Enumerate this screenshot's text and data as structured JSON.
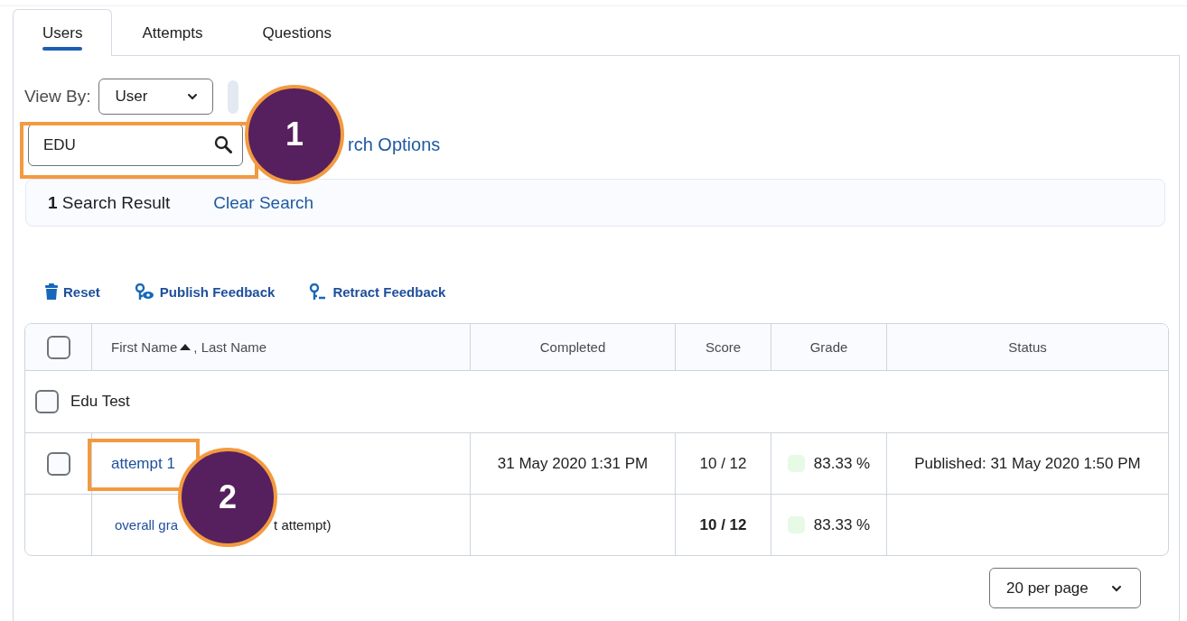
{
  "tabs": [
    {
      "label": "Users",
      "selected": true
    },
    {
      "label": "Attempts",
      "selected": false
    },
    {
      "label": "Questions",
      "selected": false
    }
  ],
  "view_by": {
    "label": "View By:",
    "value": "User"
  },
  "search": {
    "value": "EDU",
    "options_link": "rch Options"
  },
  "search_results": {
    "count": "1",
    "label": "Search Result",
    "clear": "Clear Search"
  },
  "toolbar": [
    {
      "kind": "reset",
      "label": "Reset"
    },
    {
      "kind": "publish",
      "label": "Publish Feedback"
    },
    {
      "kind": "retract",
      "label": "Retract Feedback"
    }
  ],
  "table": {
    "select_all_checked": false,
    "columns": [
      {
        "label": "First Name",
        "second_label": ", Last Name"
      },
      {
        "label": "Completed"
      },
      {
        "label": "Score"
      },
      {
        "label": "Grade"
      },
      {
        "label": "Status"
      }
    ],
    "group": {
      "name": "Edu Test",
      "checked": false
    },
    "rows": [
      {
        "kind": "attempt",
        "checked": false,
        "name_parts": [
          "attempt 1"
        ],
        "completed": "31 May 2020 1:31 PM",
        "score": "10 / 12",
        "grade": "83.33 %",
        "status": "Published: 31 May 2020 1:50 PM"
      },
      {
        "kind": "overall",
        "name_parts": [
          "overall gra",
          "t attempt)"
        ],
        "score": "10 / 12",
        "grade": "83.33 %"
      }
    ]
  },
  "per_page": "20 per page",
  "callouts": [
    {
      "number": "1"
    },
    {
      "number": "2"
    }
  ]
}
